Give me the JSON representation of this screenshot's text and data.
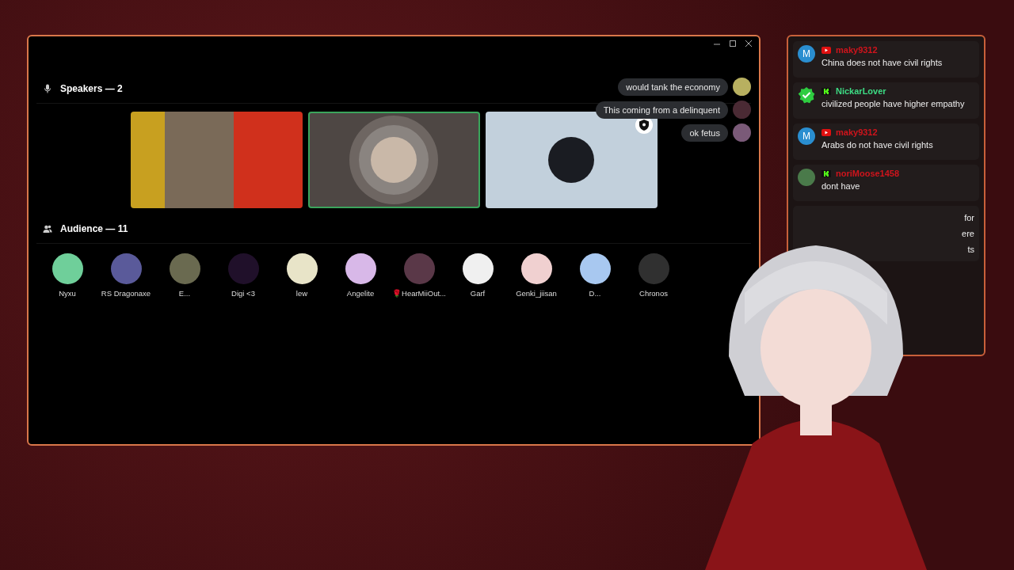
{
  "speakers": {
    "title": "Speakers — 2",
    "tiles": [
      {
        "kind": "stream",
        "speaking": false,
        "moderator": false
      },
      {
        "kind": "avatar",
        "speaking": true,
        "moderator": false,
        "color": "#c9b8a8"
      },
      {
        "kind": "avatar",
        "speaking": false,
        "moderator": true,
        "color": "#1a1c22"
      }
    ]
  },
  "reactions": [
    {
      "text": "would tank the economy",
      "color": "#b8b060"
    },
    {
      "text": "This coming from a delinquent",
      "color": "#4a2a34"
    },
    {
      "text": "ok fetus",
      "color": "#7a5a78"
    }
  ],
  "audience": {
    "title": "Audience — 11",
    "members": [
      {
        "name": "Nyxu",
        "color": "#6fcf9a"
      },
      {
        "name": "RS Dragonaxe",
        "color": "#5a5a9a"
      },
      {
        "name": "E...",
        "color": "#6a6a50"
      },
      {
        "name": "Digi <3",
        "color": "#20102a"
      },
      {
        "name": "lew",
        "color": "#e8e4c8"
      },
      {
        "name": "Angelite",
        "color": "#d8b8e8"
      },
      {
        "name": "🌹HearMiiOut...",
        "color": "#5a3848"
      },
      {
        "name": "Garf",
        "color": "#f0f0f0"
      },
      {
        "name": "Genki_jiisan",
        "color": "#f0d0d0"
      },
      {
        "name": "D...",
        "color": "#a8c8f0"
      },
      {
        "name": "Chronos",
        "color": "#303030"
      }
    ]
  },
  "chat": [
    {
      "avatar": {
        "kind": "letter",
        "text": "M"
      },
      "platform": {
        "kind": "youtube"
      },
      "name": "maky9312",
      "color": "#d0141c",
      "lines": [
        "China does not have civil rights"
      ]
    },
    {
      "avatar": {
        "kind": "badge"
      },
      "platform": {
        "kind": "kick"
      },
      "name": "NickarLover",
      "color": "#3ddc84",
      "lines": [
        "civilized people have higher empathy"
      ]
    },
    {
      "avatar": {
        "kind": "letter",
        "text": "M"
      },
      "platform": {
        "kind": "youtube"
      },
      "name": "maky9312",
      "color": "#d0141c",
      "lines": [
        "Arabs do not have civil rights"
      ]
    },
    {
      "avatar": {
        "kind": "picture"
      },
      "platform": {
        "kind": "kick"
      },
      "name": "noriMoose1458",
      "color": "#d0141c",
      "lines": [
        "dont have"
      ]
    },
    {
      "lines": [
        "for",
        "ere",
        "ts"
      ]
    }
  ]
}
